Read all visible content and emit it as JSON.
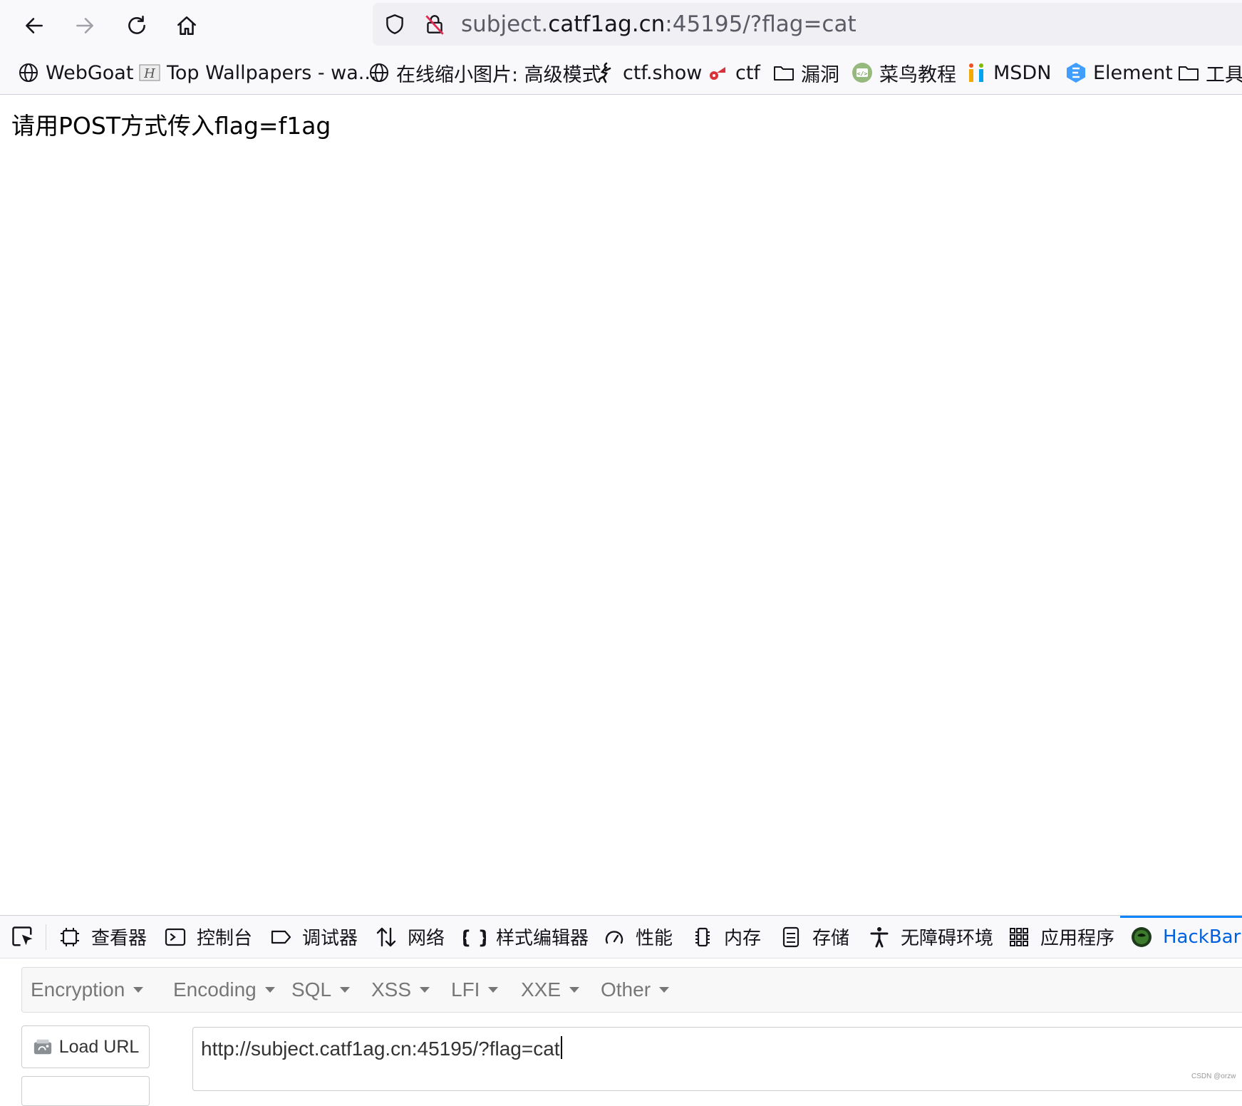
{
  "browser": {
    "url_prefix": "subject.",
    "url_host": "catf1ag.cn",
    "url_suffix": ":45195/?flag=cat"
  },
  "bookmarks": [
    {
      "label": "WebGoat",
      "icon": "globe-icon"
    },
    {
      "label": "Top Wallpapers - wa...",
      "icon": "wallpaper-site-icon"
    },
    {
      "label": "在线缩小图片: 高级模式",
      "icon": "globe-icon"
    },
    {
      "label": "ctf.show",
      "icon": "ctfshow-icon"
    },
    {
      "label": "ctf",
      "icon": "ctf-icon"
    },
    {
      "label": "漏洞",
      "icon": "folder-icon"
    },
    {
      "label": "菜鸟教程",
      "icon": "runoob-icon"
    },
    {
      "label": "MSDN",
      "icon": "msdn-icon"
    },
    {
      "label": "Element",
      "icon": "element-icon"
    },
    {
      "label": "工具",
      "icon": "folder-icon"
    }
  ],
  "page": {
    "message": "请用POST方式传入flag=f1ag"
  },
  "devtools": {
    "tabs": [
      {
        "label": "查看器",
        "icon": "inspector-icon"
      },
      {
        "label": "控制台",
        "icon": "console-icon"
      },
      {
        "label": "调试器",
        "icon": "debugger-icon"
      },
      {
        "label": "网络",
        "icon": "network-icon"
      },
      {
        "label": "样式编辑器",
        "icon": "style-editor-icon"
      },
      {
        "label": "性能",
        "icon": "performance-icon"
      },
      {
        "label": "内存",
        "icon": "memory-icon"
      },
      {
        "label": "存储",
        "icon": "storage-icon"
      },
      {
        "label": "无障碍环境",
        "icon": "accessibility-icon"
      },
      {
        "label": "应用程序",
        "icon": "application-icon"
      },
      {
        "label": "HackBar",
        "icon": "hackbar-icon",
        "active": true
      }
    ]
  },
  "hackbar": {
    "menu": [
      "Encryption",
      "Encoding",
      "SQL",
      "XSS",
      "LFI",
      "XXE",
      "Other"
    ],
    "load_url_label": "Load URL",
    "url_value": "http://subject.catf1ag.cn:45195/?flag=cat"
  },
  "watermark": "CSDN @orzw",
  "colors": {
    "accent": "#0061e0",
    "active_tab_indicator": "#0a84ff",
    "toolbar_bg": "#f9f9fb",
    "urlbar_bg": "#f0f0f4"
  }
}
